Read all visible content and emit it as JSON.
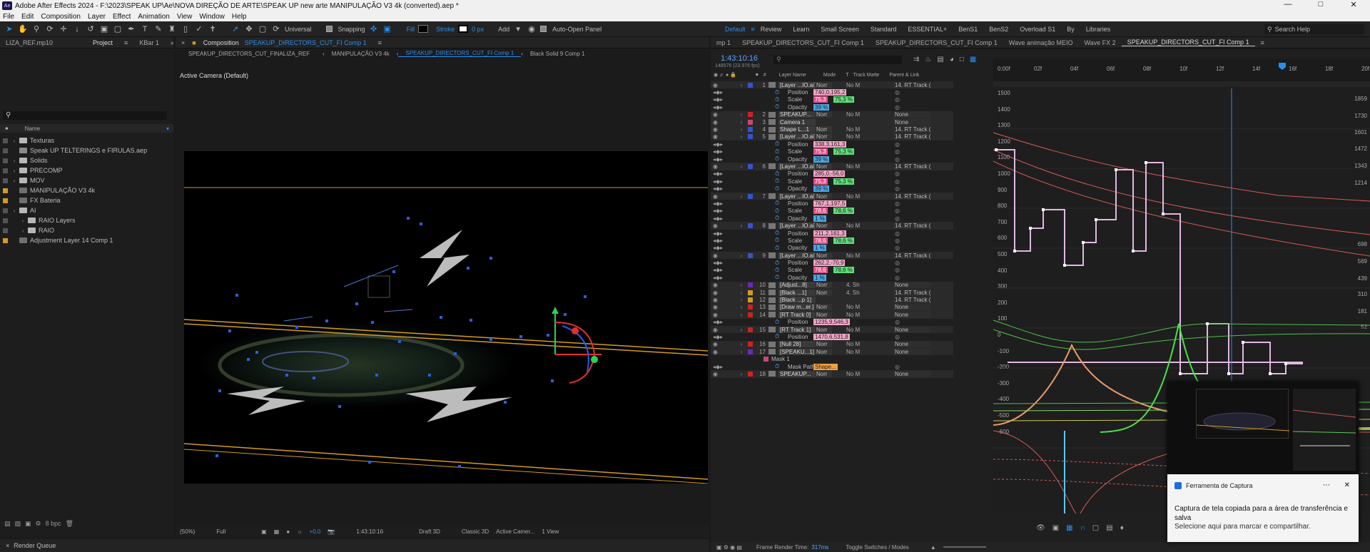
{
  "titlebar": {
    "app_icon": "Ae",
    "title": "Adobe After Effects 2024 - F:\\2023\\SPEAK UP\\Ae\\NOVA DIREÇÃO DE ARTE\\SPEAK UP new arte MANIPULAÇÃO V3 4k (converted).aep *"
  },
  "menu": [
    "File",
    "Edit",
    "Composition",
    "Layer",
    "Effect",
    "Animation",
    "View",
    "Window",
    "Help"
  ],
  "toolbar": {
    "universal": "Universal",
    "snapping": "Snapping",
    "fill": "Fill",
    "stroke": "Stroke",
    "stroke_px": "0 px",
    "add": "Add",
    "auto_open": "Auto-Open Panel"
  },
  "workspaces": [
    "Default",
    "Review",
    "Learn",
    "Small Screen",
    "Standard",
    "ESSENTIAL+",
    "BenS1",
    "BenS2",
    "Overload S1",
    "By",
    "Libraries"
  ],
  "search_help": "Search Help",
  "project": {
    "tabs": [
      "LIZA_REF.mp10",
      "Project",
      "KBar 1"
    ],
    "col_name": "Name",
    "items": [
      {
        "name": "Texturas",
        "type": "folder",
        "label": "#555"
      },
      {
        "name": "Speak UP TELTERINGS e FIRULAS.aep",
        "type": "file",
        "label": "#555"
      },
      {
        "name": "Solids",
        "type": "folder",
        "label": "#555"
      },
      {
        "name": "PRECOMP",
        "type": "folder",
        "label": "#555"
      },
      {
        "name": "MOV",
        "type": "folder",
        "label": "#555"
      },
      {
        "name": "MANIPULAÇÃO V3 4k",
        "type": "comp",
        "label": "#d59a20"
      },
      {
        "name": "FX Bateria",
        "type": "comp",
        "label": "#d59a20"
      },
      {
        "name": "AI",
        "type": "folder",
        "label": "#555"
      },
      {
        "name": "RAIO Layers",
        "type": "folder",
        "label": "#555",
        "indent": 1
      },
      {
        "name": "RAIO",
        "type": "folder",
        "label": "#555",
        "indent": 1
      },
      {
        "name": "Adjustment Layer 14 Comp 1",
        "type": "comp",
        "label": "#d59a20"
      }
    ],
    "bpc": "8 bpc"
  },
  "composition": {
    "header": "Composition",
    "comp_name": "SPEAKUP_DIRECTORS_CUT_FI Comp 1",
    "crumbs": [
      "SPEAKUP_DIRECTORS_CUT_FINALIZA_REF",
      "MANIPULAÇÃO V3 4k",
      "SPEAKUP_DIRECTORS_CUT_FI Comp 1",
      "Black Solid 9 Comp 1"
    ],
    "camera_label": "Active Camera (Default)"
  },
  "viewer_footer": {
    "zoom": "(50%)",
    "res": "Full",
    "exposure": "+0,0",
    "timecode": "1:43:10:16",
    "draft": "Draft 3D",
    "renderer": "Classic 3D",
    "camera": "Active Camer...",
    "views": "1 View"
  },
  "render_queue": "Render Queue",
  "timeline": {
    "tabs": [
      "mp 1",
      "SPEAKUP_DIRECTORS_CUT_FI Comp 1",
      "SPEAKUP_DIRECTORS_CUT_FI Comp 1",
      "Wave animação MEIO",
      "Wave FX 2",
      "SPEAKUP_DIRECTORS_CUT_FI Comp 1"
    ],
    "timecode": "1:43:10:16",
    "frame_info": "148576 (23.976 fps)",
    "col_headers": {
      "layer_name": "Layer Name",
      "mode": "Mode",
      "t": "T",
      "track_matte": "Track Matte",
      "parent": "Parent & Link"
    },
    "rows": [
      {
        "kind": "layer",
        "num": "1",
        "name": "[Layer ...IO.ai]",
        "mode": "Norr",
        "tm": "No M",
        "parent": "14. RT Track (",
        "label": "#3355cc"
      },
      {
        "kind": "prop",
        "name": "Position",
        "value": "740,0,195,2",
        "vclass": "pink"
      },
      {
        "kind": "prop",
        "name": "Scale",
        "value": "75,3",
        "value2": "75,3 %",
        "vclass": "pink2"
      },
      {
        "kind": "prop",
        "name": "Opacity",
        "value": "39 %",
        "vclass": "blue"
      },
      {
        "kind": "layer",
        "num": "2",
        "name": "SPEAKUP...",
        "mode": "Norr",
        "tm": "No M",
        "parent": "None",
        "label": "#cc2222"
      },
      {
        "kind": "layer",
        "num": "3",
        "name": "Camera 1",
        "mode": "",
        "tm": "",
        "parent": "None",
        "label": "#cc4477"
      },
      {
        "kind": "layer",
        "num": "4",
        "name": "Shape L...1",
        "mode": "Norr",
        "tm": "No M",
        "parent": "14. RT Track (",
        "label": "#3355cc"
      },
      {
        "kind": "layer",
        "num": "5",
        "name": "[Layer ...IO.ai]",
        "mode": "Norr",
        "tm": "No M",
        "parent": "14. RT Track (",
        "label": "#3355cc"
      },
      {
        "kind": "prop",
        "name": "Position",
        "value": "338,3,161,3",
        "vclass": "pink"
      },
      {
        "kind": "prop",
        "name": "Scale",
        "value": "75,3",
        "value2": "75,3 %",
        "vclass": "pink2"
      },
      {
        "kind": "prop",
        "name": "Opacity",
        "value": "39 %",
        "vclass": "blue"
      },
      {
        "kind": "layer",
        "num": "6",
        "name": "[Layer ...IO.ai]",
        "mode": "Norr",
        "tm": "No M",
        "parent": "14. RT Track (",
        "label": "#3355cc"
      },
      {
        "kind": "prop",
        "name": "Position",
        "value": "285,0,-56,0",
        "vclass": "pink"
      },
      {
        "kind": "prop",
        "name": "Scale",
        "value": "75,3",
        "value2": "75,3 %",
        "vclass": "pink2"
      },
      {
        "kind": "prop",
        "name": "Opacity",
        "value": "39 %",
        "vclass": "blue"
      },
      {
        "kind": "layer",
        "num": "7",
        "name": "[Layer ...IO.ai]",
        "mode": "Norr",
        "tm": "No M",
        "parent": "14. RT Track (",
        "label": "#3355cc"
      },
      {
        "kind": "prop",
        "name": "Position",
        "value": "767,1,197,5",
        "vclass": "pink"
      },
      {
        "kind": "prop",
        "name": "Scale",
        "value": "78,6",
        "value2": "78,6 %",
        "vclass": "pink2"
      },
      {
        "kind": "prop",
        "name": "Opacity",
        "value": "1 %",
        "vclass": "blue"
      },
      {
        "kind": "layer",
        "num": "8",
        "name": "[Layer ...IO.ai]",
        "mode": "Norr",
        "tm": "No M",
        "parent": "14. RT Track (",
        "label": "#3355cc"
      },
      {
        "kind": "prop",
        "name": "Position",
        "value": "211,2,161,3",
        "vclass": "pink"
      },
      {
        "kind": "prop",
        "name": "Scale",
        "value": "78,6",
        "value2": "78,6 %",
        "vclass": "pink2"
      },
      {
        "kind": "prop",
        "name": "Opacity",
        "value": "1 %",
        "vclass": "blue"
      },
      {
        "kind": "layer",
        "num": "9",
        "name": "[Layer ...IO.ai]",
        "mode": "Norr",
        "tm": "No M",
        "parent": "14. RT Track (",
        "label": "#3355cc"
      },
      {
        "kind": "prop",
        "name": "Position",
        "value": "262,2,-70,9",
        "vclass": "pink"
      },
      {
        "kind": "prop",
        "name": "Scale",
        "value": "78,6",
        "value2": "78,6 %",
        "vclass": "pink2"
      },
      {
        "kind": "prop",
        "name": "Opacity",
        "value": "1 %",
        "vclass": "blue"
      },
      {
        "kind": "layer",
        "num": "10",
        "name": "[Adjust...8]",
        "mode": "Norr",
        "tm": "4. Sh",
        "parent": "None",
        "label": "#6a2ab8"
      },
      {
        "kind": "layer",
        "num": "11",
        "name": "[Black ...1]",
        "mode": "Norr",
        "tm": "4. Sh",
        "parent": "14. RT Track (",
        "label": "#d59a20"
      },
      {
        "kind": "layer",
        "num": "12",
        "name": "[Black ...p 1]",
        "mode": "",
        "tm": "",
        "parent": "14. RT Track (",
        "label": "#d59a20"
      },
      {
        "kind": "layer",
        "num": "13",
        "name": "[Draw m...er.]",
        "mode": "Norr",
        "tm": "No M",
        "parent": "None",
        "label": "#cc2222"
      },
      {
        "kind": "layer",
        "num": "14",
        "name": "[RT Track 0]",
        "mode": "Norr",
        "tm": "No M",
        "parent": "None",
        "label": "#cc2222"
      },
      {
        "kind": "prop",
        "name": "Position",
        "value": "1235,9,546,3",
        "vclass": "pink"
      },
      {
        "kind": "layer",
        "num": "15",
        "name": "[RT Track 1]",
        "mode": "Norr",
        "tm": "No M",
        "parent": "None",
        "label": "#cc2222"
      },
      {
        "kind": "prop",
        "name": "Position",
        "value": "1470,6,531,8",
        "vclass": "pink"
      },
      {
        "kind": "layer",
        "num": "16",
        "name": "[Null 28]",
        "mode": "Norr",
        "tm": "No M",
        "parent": "None",
        "label": "#cc2222"
      },
      {
        "kind": "layer",
        "num": "17",
        "name": "[SPEAKU...1]",
        "mode": "Norr",
        "tm": "No M",
        "parent": "None",
        "label": "#6a2ab8"
      },
      {
        "kind": "sub",
        "name": "Mask 1",
        "label": "#cc4477"
      },
      {
        "kind": "prop",
        "name": "Mask Path",
        "value": "Shape...",
        "vclass": "orange"
      },
      {
        "kind": "layer",
        "num": "18",
        "name": "SPEAKUP...",
        "mode": "Norr",
        "tm": "No M",
        "parent": "None",
        "label": "#cc2222"
      }
    ],
    "footer": {
      "frame_render_label": "Frame Render Time:",
      "frame_render_value": "317ms",
      "toggle": "Toggle Switches / Modes"
    }
  },
  "graph": {
    "time_ticks": [
      "0:00f",
      "02f",
      "04f",
      "06f",
      "08f",
      "10f",
      "12f",
      "14f",
      "16f",
      "18f",
      "20f"
    ],
    "left_ticks": [
      "1500",
      "1400",
      "1300",
      "1200",
      "1100",
      "1000",
      "900",
      "800",
      "700",
      "600",
      "500",
      "400",
      "300",
      "200",
      "100",
      "0",
      "-100",
      "-200",
      "-300",
      "-400",
      "-500",
      "-600"
    ],
    "right_ticks": [
      "1859",
      "1730",
      "1601",
      "1472",
      "1343",
      "1214",
      "698",
      "569",
      "439",
      "310",
      "181",
      "52"
    ]
  },
  "toast": {
    "app": "Ferramenta de Captura",
    "msg": "Captura de tela copiada para a área de transferência e salva",
    "sub": "Selecione aqui para marcar e compartilhar."
  }
}
